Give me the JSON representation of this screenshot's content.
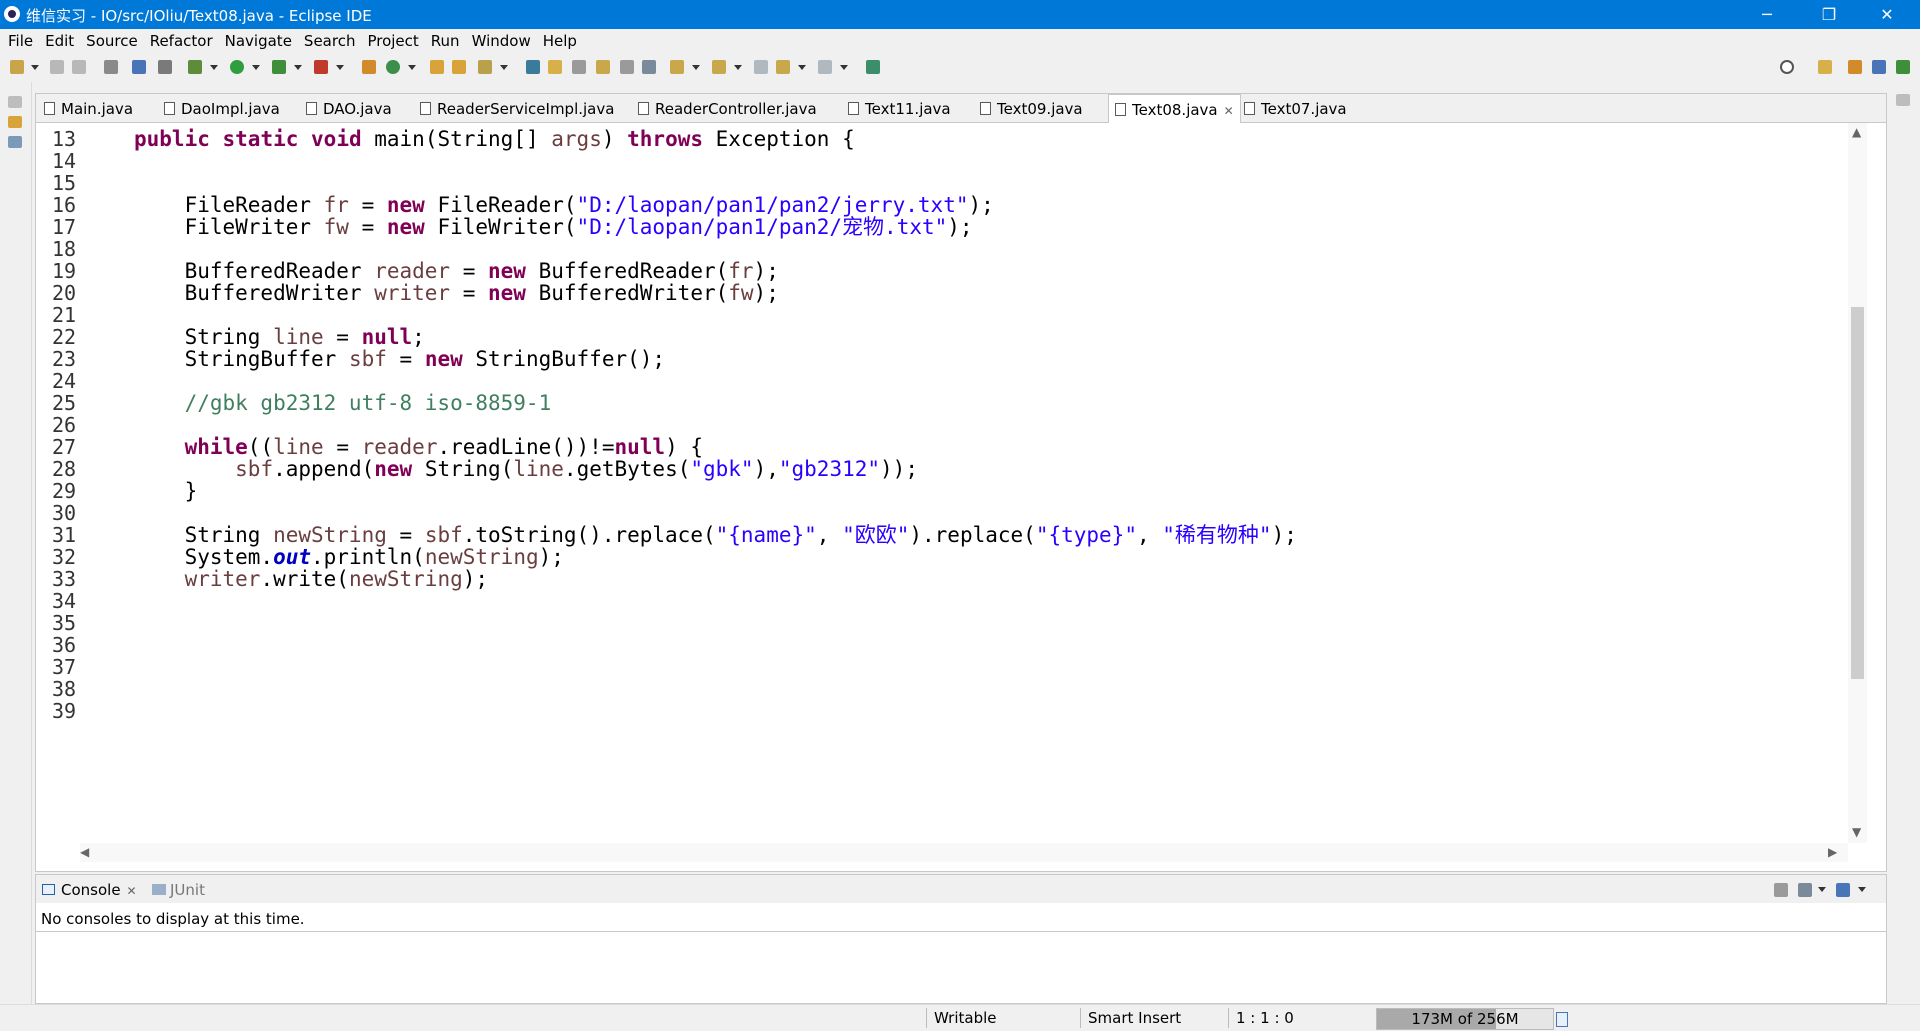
{
  "window": {
    "title": "维信实习 - IO/src/IOliu/Text08.java - Eclipse IDE",
    "minimize_glyph": "─",
    "restore_glyph": "❐",
    "close_glyph": "✕"
  },
  "menu": [
    "File",
    "Edit",
    "Source",
    "Refactor",
    "Navigate",
    "Search",
    "Project",
    "Run",
    "Window",
    "Help"
  ],
  "tabs": [
    {
      "label": "Main.java",
      "active": false
    },
    {
      "label": "DaoImpl.java",
      "active": false
    },
    {
      "label": "DAO.java",
      "active": false
    },
    {
      "label": "ReaderServiceImpl.java",
      "active": false
    },
    {
      "label": "ReaderController.java",
      "active": false
    },
    {
      "label": "Text11.java",
      "active": false
    },
    {
      "label": "Text09.java",
      "active": false
    },
    {
      "label": "Text08.java",
      "active": true,
      "close_glyph": "✕"
    },
    {
      "label": "Text07.java",
      "active": false
    }
  ],
  "code": {
    "lines": [
      {
        "n": "13",
        "t": "public static void main(String[] args) throws Exception {"
      },
      {
        "n": "14",
        "t": ""
      },
      {
        "n": "15",
        "t": ""
      },
      {
        "n": "16",
        "t": "    FileReader fr = new FileReader(\"D:/laopan/pan1/pan2/jerry.txt\");"
      },
      {
        "n": "17",
        "t": "    FileWriter fw = new FileWriter(\"D:/laopan/pan1/pan2/宠物.txt\");"
      },
      {
        "n": "18",
        "t": ""
      },
      {
        "n": "19",
        "t": "    BufferedReader reader = new BufferedReader(fr);"
      },
      {
        "n": "20",
        "t": "    BufferedWriter writer = new BufferedWriter(fw);"
      },
      {
        "n": "21",
        "t": ""
      },
      {
        "n": "22",
        "t": "    String line = null;"
      },
      {
        "n": "23",
        "t": "    StringBuffer sbf = new StringBuffer();"
      },
      {
        "n": "24",
        "t": ""
      },
      {
        "n": "25",
        "t": "    //gbk gb2312 utf-8 iso-8859-1"
      },
      {
        "n": "26",
        "t": ""
      },
      {
        "n": "27",
        "t": "    while((line = reader.readLine())!=null) {"
      },
      {
        "n": "28",
        "t": "        sbf.append(new String(line.getBytes(\"gbk\"),\"gb2312\"));"
      },
      {
        "n": "29",
        "t": "    }"
      },
      {
        "n": "30",
        "t": ""
      },
      {
        "n": "31",
        "t": "    String newString = sbf.toString().replace(\"{name}\", \"欧欧\").replace(\"{type}\", \"稀有物种\");"
      },
      {
        "n": "32",
        "t": "    System.out.println(newString);"
      },
      {
        "n": "33",
        "t": "    writer.write(newString);"
      },
      {
        "n": "34",
        "t": ""
      },
      {
        "n": "35",
        "t": ""
      },
      {
        "n": "36",
        "t": ""
      },
      {
        "n": "37",
        "t": ""
      },
      {
        "n": "38",
        "t": ""
      },
      {
        "n": "39",
        "t": ""
      }
    ],
    "keywords": [
      "public",
      "static",
      "void",
      "throws",
      "new",
      "null",
      "while"
    ],
    "variables": [
      "args",
      "fr",
      "fw",
      "reader",
      "writer",
      "line",
      "sbf",
      "newString"
    ]
  },
  "console": {
    "tabs": [
      {
        "label": "Console",
        "active": true,
        "close_glyph": "✕"
      },
      {
        "label": "JUnit",
        "active": false
      }
    ],
    "message": "No consoles to display at this time."
  },
  "status": {
    "writable": "Writable",
    "insert_mode": "Smart Insert",
    "position": "1 : 1 : 0",
    "heap": "173M of 256M",
    "heap_fraction": 0.676
  },
  "colors": {
    "title_bar": "#0078d7",
    "keyword": "#7f0055",
    "string": "#2a00ff",
    "comment": "#3f7f5f",
    "variable": "#6a3e3e",
    "field": "#0000c0"
  }
}
